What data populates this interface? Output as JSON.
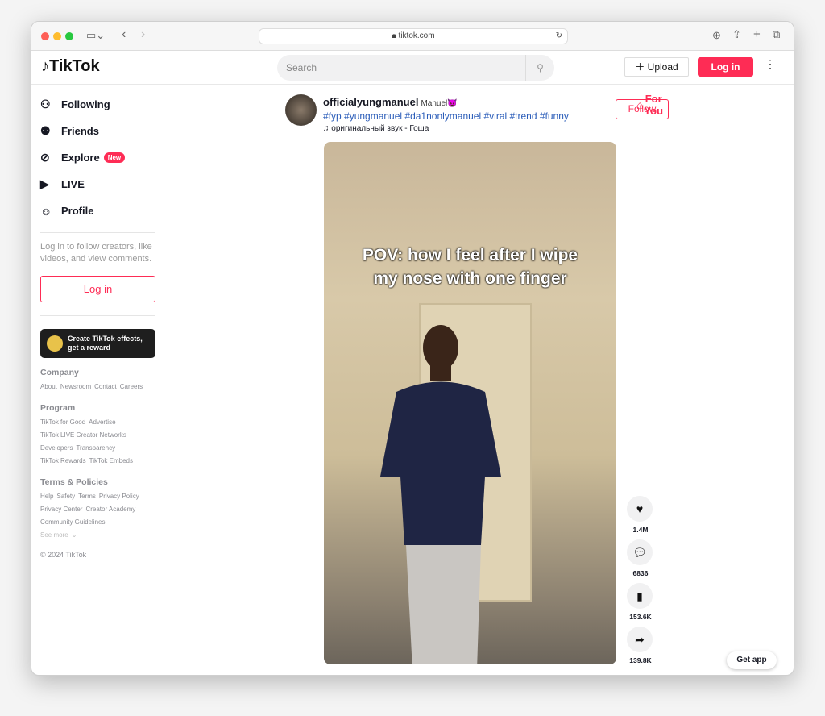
{
  "browser": {
    "url": "tiktok.com"
  },
  "header": {
    "logo": "TikTok",
    "search_placeholder": "Search",
    "upload": "Upload",
    "login": "Log in"
  },
  "sidebar": {
    "items": [
      {
        "label": "For You",
        "icon": "home-icon",
        "active": true
      },
      {
        "label": "Following",
        "icon": "following-icon"
      },
      {
        "label": "Friends",
        "icon": "friends-icon"
      },
      {
        "label": "Explore",
        "icon": "compass-icon",
        "badge": "New"
      },
      {
        "label": "LIVE",
        "icon": "live-icon"
      },
      {
        "label": "Profile",
        "icon": "profile-icon"
      }
    ],
    "login_message": "Log in to follow creators, like videos, and view comments.",
    "login": "Log in",
    "effects_banner": "Create TikTok effects, get a reward",
    "footer": {
      "company": {
        "title": "Company",
        "links": [
          "About",
          "Newsroom",
          "Contact",
          "Careers"
        ]
      },
      "program": {
        "title": "Program",
        "rows": [
          [
            "TikTok for Good",
            "Advertise"
          ],
          [
            "TikTok LIVE Creator Networks"
          ],
          [
            "Developers",
            "Transparency"
          ],
          [
            "TikTok Rewards",
            "TikTok Embeds"
          ]
        ]
      },
      "terms": {
        "title": "Terms & Policies",
        "rows": [
          [
            "Help",
            "Safety",
            "Terms",
            "Privacy Policy"
          ],
          [
            "Privacy Center",
            "Creator Academy"
          ],
          [
            "Community Guidelines"
          ]
        ]
      },
      "see_more": "See more",
      "copyright": "© 2024 TikTok"
    }
  },
  "post": {
    "username": "officialyungmanuel",
    "nickname": "Manuel😈",
    "hashtags": "#fyp #yungmanuel #da1nonlymanuel #viral #trend #funny",
    "sound": "оригинальный звук - Гоша",
    "follow": "Follow",
    "caption": "POV: how I feel after I wipe my nose with one finger",
    "actions": [
      {
        "icon": "heart-icon",
        "count": "1.4M"
      },
      {
        "icon": "comment-icon",
        "count": "6836"
      },
      {
        "icon": "bookmark-icon",
        "count": "153.6K"
      },
      {
        "icon": "share-icon",
        "count": "139.8K"
      }
    ]
  },
  "get_app": "Get app",
  "colors": {
    "brand": "#fe2c55",
    "hashtag": "#2b5db9"
  }
}
